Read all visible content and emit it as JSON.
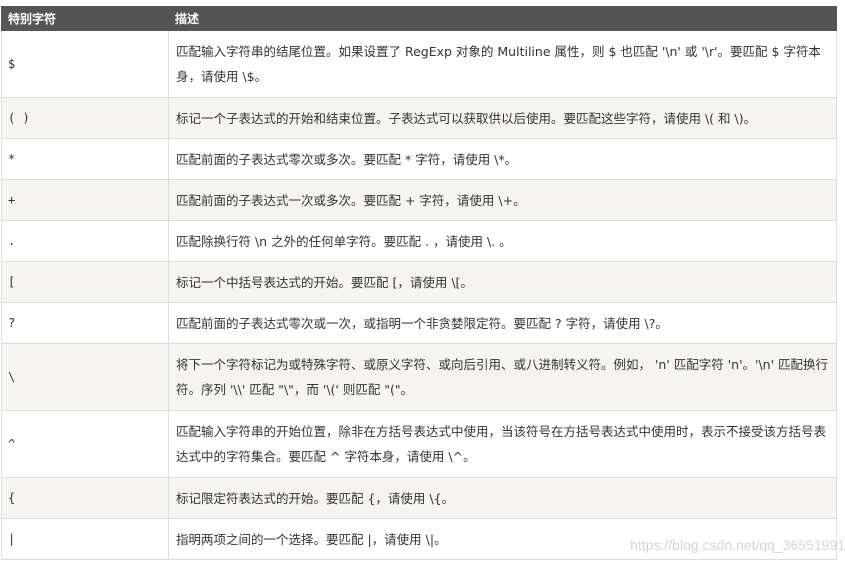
{
  "table": {
    "headers": [
      "特别字符",
      "描述"
    ],
    "rows": [
      {
        "char": "$",
        "desc": "匹配输入字符串的结尾位置。如果设置了 RegExp 对象的 Multiline 属性，则 $ 也匹配 '\\n' 或 '\\r'。要匹配 $ 字符本身，请使用 \\$。"
      },
      {
        "char": "( )",
        "desc": "标记一个子表达式的开始和结束位置。子表达式可以获取供以后使用。要匹配这些字符，请使用 \\( 和 \\)。"
      },
      {
        "char": "*",
        "desc": "匹配前面的子表达式零次或多次。要匹配 * 字符，请使用 \\*。"
      },
      {
        "char": "+",
        "desc": "匹配前面的子表达式一次或多次。要匹配 + 字符，请使用 \\+。"
      },
      {
        "char": ".",
        "desc": "匹配除换行符 \\n 之外的任何单字符。要匹配 . ，请使用 \\. 。"
      },
      {
        "char": "[",
        "desc": "标记一个中括号表达式的开始。要匹配 [，请使用 \\[。"
      },
      {
        "char": "?",
        "desc": "匹配前面的子表达式零次或一次，或指明一个非贪婪限定符。要匹配 ? 字符，请使用 \\?。"
      },
      {
        "char": "\\",
        "desc": "将下一个字符标记为或特殊字符、或原义字符、或向后引用、或八进制转义符。例如， 'n' 匹配字符 'n'。'\\n' 匹配换行符。序列 '\\\\' 匹配 \"\\\"，而 '\\(' 则匹配 \"(\"。"
      },
      {
        "char": "^",
        "desc": "匹配输入字符串的开始位置，除非在方括号表达式中使用，当该符号在方括号表达式中使用时，表示不接受该方括号表达式中的字符集合。要匹配 ^ 字符本身，请使用 \\^。"
      },
      {
        "char": "{",
        "desc": "标记限定符表达式的开始。要匹配 {，请使用 \\{。"
      },
      {
        "char": "|",
        "desc": "指明两项之间的一个选择。要匹配 |，请使用 \\|。"
      }
    ]
  },
  "watermark": "https://blog.csdn.net/qq_36551991",
  "colors": {
    "header_bg": "#555555",
    "header_text": "#ffffff",
    "row_alt_bg": "#f6f4f0",
    "border": "#dddddd",
    "text": "#333333"
  }
}
